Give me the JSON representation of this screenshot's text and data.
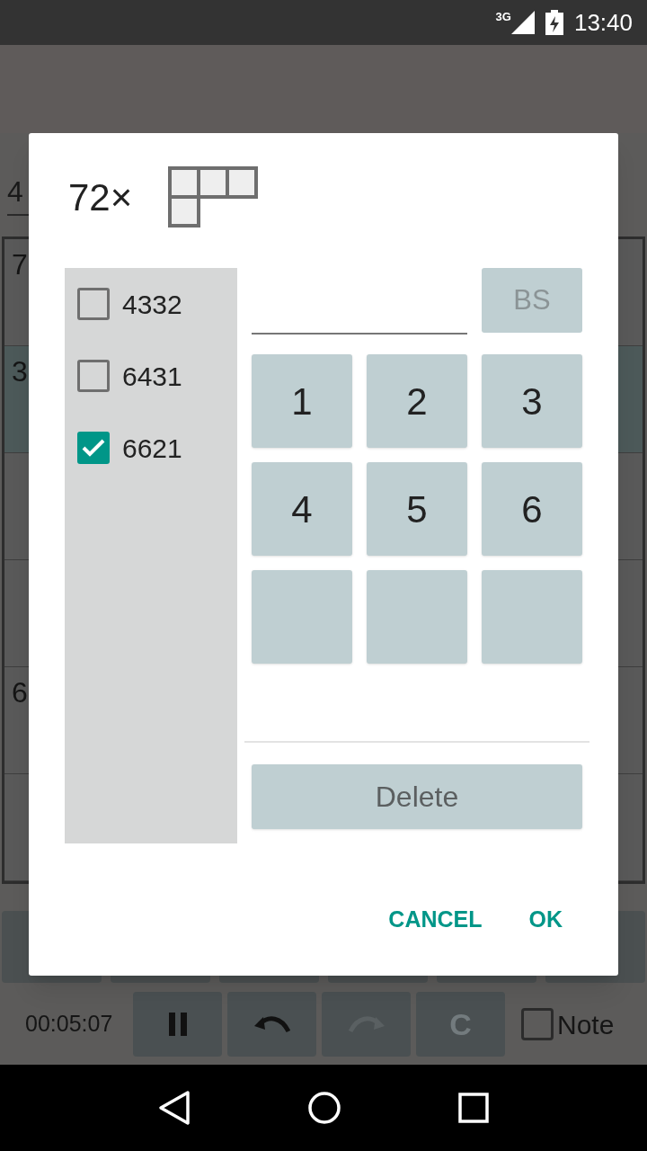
{
  "status_bar": {
    "network": "3G",
    "time": "13:40"
  },
  "background": {
    "field_value": "4",
    "grid_rows": [
      {
        "label": "7",
        "selected": false
      },
      {
        "label": "3",
        "selected": true
      },
      {
        "selected": false
      },
      {
        "selected": false
      },
      {
        "label": "6",
        "selected": false
      },
      {
        "selected": false
      }
    ],
    "timer": "00:05:07",
    "tools": [
      {
        "kind": "pause",
        "disabled": false
      },
      {
        "kind": "undo",
        "disabled": false
      },
      {
        "kind": "redo",
        "disabled": true
      },
      {
        "kind": "clear",
        "label": "C",
        "disabled": true
      }
    ],
    "note": {
      "label": "Note",
      "checked": false
    }
  },
  "dialog": {
    "title": "72×",
    "options": [
      {
        "label": "4332",
        "checked": false
      },
      {
        "label": "6431",
        "checked": false
      },
      {
        "label": "6621",
        "checked": true
      }
    ],
    "backspace": {
      "label": "BS",
      "disabled": true
    },
    "keys": [
      {
        "kind": "digit",
        "label": "1"
      },
      {
        "kind": "digit",
        "label": "2"
      },
      {
        "kind": "digit",
        "label": "3"
      },
      {
        "kind": "digit",
        "label": "4"
      },
      {
        "kind": "digit",
        "label": "5"
      },
      {
        "kind": "digit",
        "label": "6"
      },
      {
        "kind": "blank"
      },
      {
        "kind": "blank"
      },
      {
        "kind": "blank"
      }
    ],
    "delete": {
      "label": "Delete",
      "disabled": false
    },
    "actions": [
      "CANCEL",
      "OK"
    ]
  }
}
